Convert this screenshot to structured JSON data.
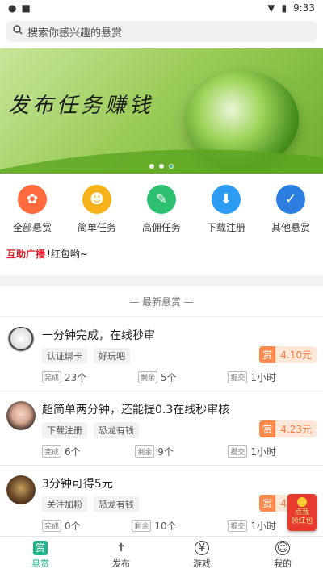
{
  "status_bar": {
    "time": "9:33"
  },
  "search": {
    "placeholder": "搜索你感兴趣的悬赏"
  },
  "banner": {
    "title": "发布任务赚钱"
  },
  "categories": [
    {
      "label": "全部悬赏",
      "icon": "clover-icon",
      "color": "#ff6a3d"
    },
    {
      "label": "简单任务",
      "icon": "user-icon",
      "color": "#f7b21b"
    },
    {
      "label": "高佣任务",
      "icon": "edit-icon",
      "color": "#2fbf71"
    },
    {
      "label": "下载注册",
      "icon": "download-icon",
      "color": "#2b9cf2"
    },
    {
      "label": "其他悬赏",
      "icon": "clipboard-icon",
      "color": "#2c7fe0"
    }
  ],
  "broadcast": {
    "tag": "互助广播",
    "text": "!红包哟~"
  },
  "latest_header": "最新悬赏",
  "tasks": [
    {
      "title": "一分钟完成，在线秒审",
      "tags": [
        "认证绑卡",
        "好玩吧"
      ],
      "reward": "4.10元",
      "done": "23个",
      "remain": "5个",
      "submit": "1小时"
    },
    {
      "title": "超简单两分钟，还能提0.3在线秒审核",
      "tags": [
        "下载注册",
        "恐龙有钱"
      ],
      "reward": "4.23元",
      "done": "6个",
      "remain": "9个",
      "submit": "1小时"
    },
    {
      "title": "3分钟可得5元",
      "tags": [
        "关注加粉",
        "恐龙有钱"
      ],
      "reward": "4.23元",
      "done": "0个",
      "remain": "10个",
      "submit": "1小时"
    }
  ],
  "labels": {
    "reward": "赏",
    "done": "完成",
    "remain": "剩余",
    "submit": "提交"
  },
  "redpack": {
    "line1": "点我",
    "line2": "领红包"
  },
  "tabs": [
    {
      "label": "悬赏",
      "icon": "reward-icon",
      "glyph": "赏"
    },
    {
      "label": "发布",
      "icon": "publish-icon",
      "glyph": "✝"
    },
    {
      "label": "游戏",
      "icon": "game-icon",
      "glyph": "¥"
    },
    {
      "label": "我的",
      "icon": "profile-icon",
      "glyph": "☺"
    }
  ],
  "colors": {
    "accent": "#21b38a",
    "reward": "#ff8a4c",
    "broadcast": "#e0202a"
  }
}
